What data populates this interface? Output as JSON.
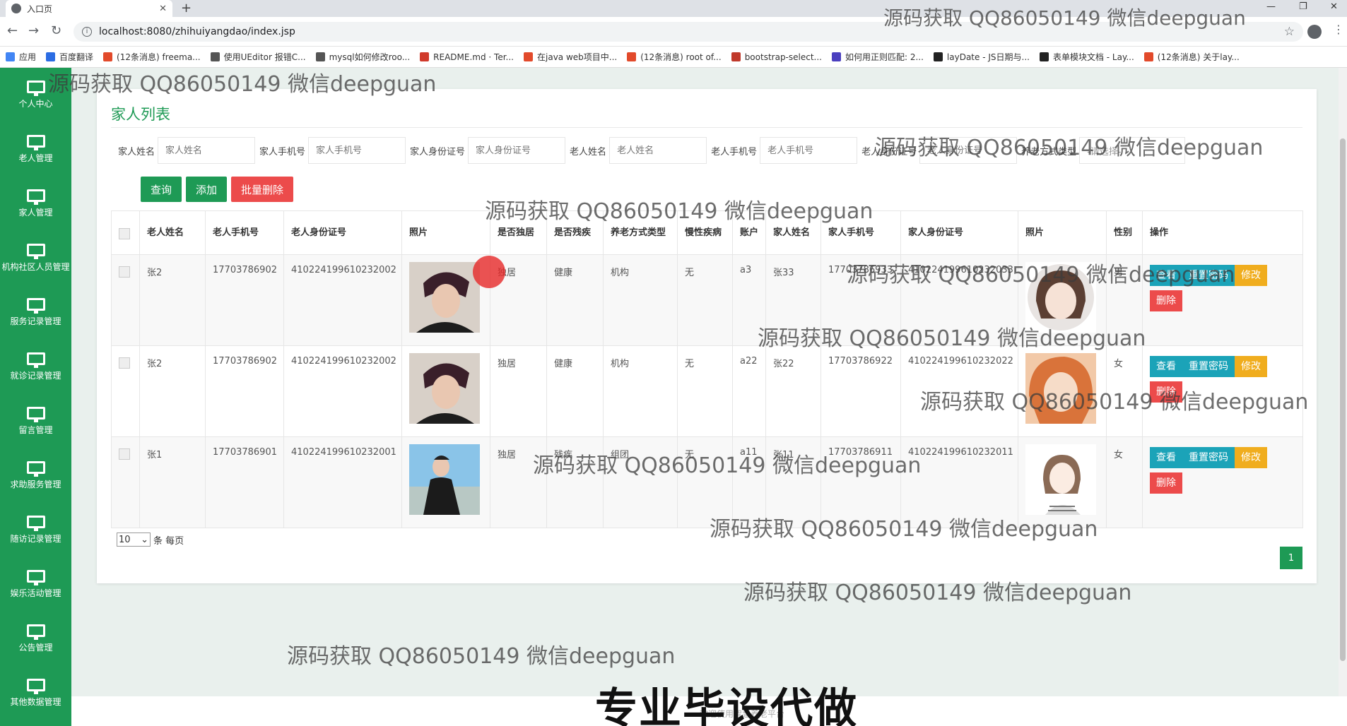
{
  "browser": {
    "tab_title": "入口页",
    "tab_close": "✕",
    "new_tab": "+",
    "url": "localhost:8080/zhihuiyangdao/index.jsp",
    "bookmarks": [
      {
        "label": "应用",
        "color": "#4285f4"
      },
      {
        "label": "百度翻译",
        "color": "#2b6ce3"
      },
      {
        "label": "(12条消息) freema...",
        "color": "#e24a2b"
      },
      {
        "label": "使用UEditor 报错C...",
        "color": "#555555"
      },
      {
        "label": "mysql如何修改roo...",
        "color": "#555555"
      },
      {
        "label": "README.md · Ter...",
        "color": "#d03a2b"
      },
      {
        "label": "在java web项目中...",
        "color": "#e24a2b"
      },
      {
        "label": "(12条消息) root of...",
        "color": "#e24a2b"
      },
      {
        "label": "bootstrap-select...",
        "color": "#c0392b"
      },
      {
        "label": "如何用正则匹配: 2...",
        "color": "#4a3fbf"
      },
      {
        "label": "layDate - JS日期与...",
        "color": "#222222"
      },
      {
        "label": "表单模块文档 - Lay...",
        "color": "#222222"
      },
      {
        "label": "(12条消息) 关于lay...",
        "color": "#e24a2b"
      }
    ]
  },
  "sidebar": {
    "items": [
      {
        "label": "个人中心"
      },
      {
        "label": "老人管理"
      },
      {
        "label": "家人管理"
      },
      {
        "label": "机构社区人员管理"
      },
      {
        "label": "服务记录管理"
      },
      {
        "label": "就诊记录管理"
      },
      {
        "label": "留言管理"
      },
      {
        "label": "求助服务管理"
      },
      {
        "label": "随访记录管理"
      },
      {
        "label": "娱乐活动管理"
      },
      {
        "label": "公告管理"
      },
      {
        "label": "其他数据管理"
      }
    ]
  },
  "page": {
    "title": "家人列表",
    "search": {
      "family_name_label": "家人姓名",
      "family_name_placeholder": "家人姓名",
      "family_phone_label": "家人手机号",
      "family_phone_placeholder": "家人手机号",
      "family_id_label": "家人身份证号",
      "family_id_placeholder": "家人身份证号",
      "elder_name_label": "老人姓名",
      "elder_name_placeholder": "老人姓名",
      "elder_phone_label": "老人手机号",
      "elder_phone_placeholder": "老人手机号",
      "elder_id_label": "老人身份证号",
      "elder_id_placeholder": "老人身份证号",
      "care_type_label": "养老方式类型",
      "care_type_value": "-请选择-"
    },
    "buttons": {
      "query": "查询",
      "add": "添加",
      "batch_delete": "批量删除"
    },
    "columns": [
      "老人姓名",
      "老人手机号",
      "老人身份证号",
      "照片",
      "是否独居",
      "是否残疾",
      "养老方式类型",
      "慢性疾病",
      "账户",
      "家人姓名",
      "家人手机号",
      "家人身份证号",
      "照片",
      "性别",
      "操作"
    ],
    "actions": {
      "view": "查看",
      "reset": "重置密码",
      "edit": "修改",
      "delete": "删除"
    },
    "rows": [
      {
        "elder_name": "张2",
        "elder_phone": "17703786902",
        "elder_id": "410224199610232002",
        "alone": "独居",
        "disabled": "健康",
        "care_type": "机构",
        "chronic": "无",
        "account": "a3",
        "family_name": "张33",
        "family_phone": "17703786933",
        "family_id": "410224199610232033",
        "gender": "男"
      },
      {
        "elder_name": "张2",
        "elder_phone": "17703786902",
        "elder_id": "410224199610232002",
        "alone": "独居",
        "disabled": "健康",
        "care_type": "机构",
        "chronic": "无",
        "account": "a22",
        "family_name": "张22",
        "family_phone": "17703786922",
        "family_id": "410224199610232022",
        "gender": "女"
      },
      {
        "elder_name": "张1",
        "elder_phone": "17703786901",
        "elder_id": "410224199610232001",
        "alone": "独居",
        "disabled": "残疾",
        "care_type": "组团",
        "chronic": "无",
        "account": "a11",
        "family_name": "张11",
        "family_phone": "17703786911",
        "family_id": "410224199610232011",
        "gender": "女"
      }
    ],
    "pager": {
      "page_size": "10",
      "per_page_label": "条 每页",
      "current_page": "1"
    }
  },
  "watermark": "源码获取 QQ86050149 微信deepguan",
  "banner": "专业毕设代做",
  "footer": "欢迎使用智慧养老平台",
  "colors": {
    "sidebar": "#1e9a55",
    "accent": "#1e9a55",
    "danger": "#ec4b4b",
    "info": "#1ba3b8",
    "warning": "#f0ad1e"
  }
}
